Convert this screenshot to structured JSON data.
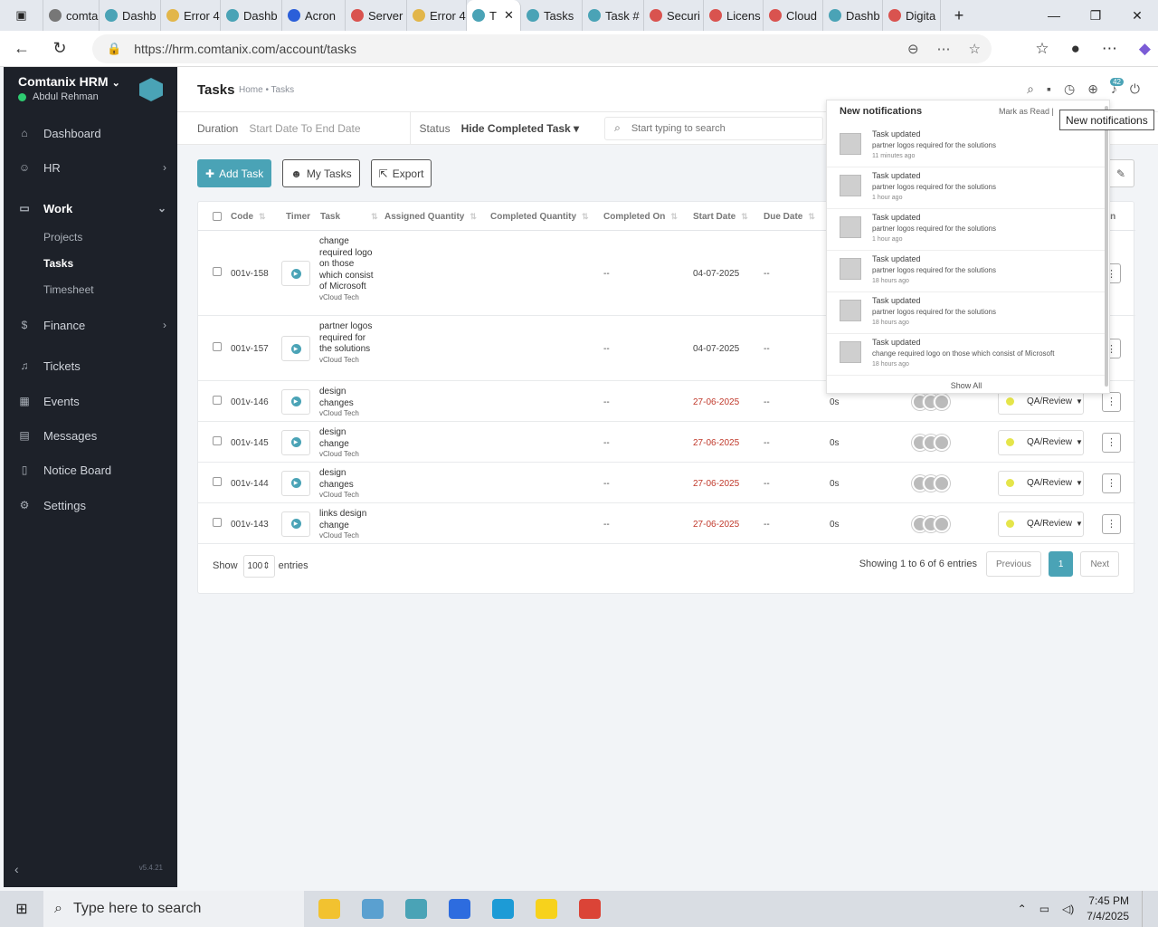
{
  "browser": {
    "tabs": [
      {
        "label": "comta",
        "color": "#777"
      },
      {
        "label": "Dashb",
        "color": "#4aa3b6"
      },
      {
        "label": "Error 4",
        "color": "#e2b64a"
      },
      {
        "label": "Dashb",
        "color": "#4aa3b6"
      },
      {
        "label": "Acron",
        "color": "#2b5fd9"
      },
      {
        "label": "Server",
        "color": "#d9534f"
      },
      {
        "label": "Error 4",
        "color": "#e2b64a"
      },
      {
        "label": "T",
        "color": "#4aa3b6",
        "active": true
      },
      {
        "label": "Tasks",
        "color": "#4aa3b6"
      },
      {
        "label": "Task #",
        "color": "#4aa3b6"
      },
      {
        "label": "Securi",
        "color": "#d9534f"
      },
      {
        "label": "Licens",
        "color": "#d9534f"
      },
      {
        "label": "Cloud",
        "color": "#d9534f"
      },
      {
        "label": "Dashb",
        "color": "#4aa3b6"
      },
      {
        "label": "Digita",
        "color": "#d9534f"
      }
    ],
    "url": "https://hrm.comtanix.com/account/tasks"
  },
  "sidebar": {
    "brand": "Comtanix HRM",
    "user": "Abdul Rehman",
    "items": [
      {
        "label": "Dashboard",
        "icon": "home-icon"
      },
      {
        "label": "HR",
        "icon": "users-icon"
      },
      {
        "label": "Work",
        "icon": "briefcase-icon"
      },
      {
        "label": "Finance",
        "icon": "dollar-icon"
      },
      {
        "label": "Tickets",
        "icon": "headset-icon"
      },
      {
        "label": "Events",
        "icon": "calendar-icon"
      },
      {
        "label": "Messages",
        "icon": "chat-icon"
      },
      {
        "label": "Notice Board",
        "icon": "clipboard-icon"
      },
      {
        "label": "Settings",
        "icon": "gear-icon"
      }
    ],
    "work_sub": [
      "Projects",
      "Tasks",
      "Timesheet"
    ],
    "version": "v5.4.21"
  },
  "page": {
    "title": "Tasks",
    "breadcrumb": "Home • Tasks",
    "notif_count": "42",
    "filters": {
      "duration_label": "Duration",
      "duration_value": "Start Date To End Date",
      "status_label": "Status",
      "status_value": "Hide Completed Task ▾",
      "search_placeholder": "Start typing to search"
    },
    "buttons": {
      "add": "Add Task",
      "my": "My Tasks",
      "export": "Export"
    }
  },
  "table": {
    "columns": [
      "Code",
      "Timer",
      "Task",
      "Assigned Quantity",
      "Completed Quantity",
      "Completed On",
      "Start Date",
      "Due Date",
      "on"
    ],
    "rows": [
      {
        "code": "001v-158",
        "task": "change required logo on those which consist of Microsoft",
        "project": "vCloud Tech",
        "completed_on": "--",
        "start": "04-07-2025",
        "due": "--",
        "hours": "",
        "status": "",
        "start_red": false
      },
      {
        "code": "001v-157",
        "task": "partner logos required for the solutions",
        "project": "vCloud Tech",
        "completed_on": "--",
        "start": "04-07-2025",
        "due": "--",
        "hours": "",
        "status": "",
        "start_red": false
      },
      {
        "code": "001v-146",
        "task": "design changes",
        "project": "vCloud Tech",
        "completed_on": "--",
        "start": "27-06-2025",
        "due": "--",
        "hours": "0s",
        "status": "QA/Review",
        "start_red": true
      },
      {
        "code": "001v-145",
        "task": "design change",
        "project": "vCloud Tech",
        "completed_on": "--",
        "start": "27-06-2025",
        "due": "--",
        "hours": "0s",
        "status": "QA/Review",
        "start_red": true
      },
      {
        "code": "001v-144",
        "task": "design changes",
        "project": "vCloud Tech",
        "completed_on": "--",
        "start": "27-06-2025",
        "due": "--",
        "hours": "0s",
        "status": "QA/Review",
        "start_red": true
      },
      {
        "code": "001v-143",
        "task": "links design change",
        "project": "vCloud Tech",
        "completed_on": "--",
        "start": "27-06-2025",
        "due": "--",
        "hours": "0s",
        "status": "QA/Review",
        "start_red": true
      }
    ],
    "footer": {
      "show": "Show",
      "entries_value": "100",
      "entries": "entries",
      "info": "Showing 1 to 6 of 6 entries",
      "prev": "Previous",
      "page": "1",
      "next": "Next"
    }
  },
  "notifications": {
    "title": "New notifications",
    "mark": "Mark as Read |",
    "tooltip": "New notifications",
    "show_all": "Show All",
    "items": [
      {
        "title": "Task updated",
        "text": "partner logos required for the solutions",
        "time": "11 minutes ago"
      },
      {
        "title": "Task updated",
        "text": "partner logos required for the solutions",
        "time": "1 hour ago"
      },
      {
        "title": "Task updated",
        "text": "partner logos required for the solutions",
        "time": "1 hour ago"
      },
      {
        "title": "Task updated",
        "text": "partner logos required for the solutions",
        "time": "18 hours ago"
      },
      {
        "title": "Task updated",
        "text": "partner logos required for the solutions",
        "time": "18 hours ago"
      },
      {
        "title": "Task updated",
        "text": "change required logo on those which consist of Microsoft",
        "time": "18 hours ago"
      }
    ]
  },
  "taskbar": {
    "search": "Type here to search",
    "time": "7:45 PM",
    "date": "7/4/2025",
    "apps": [
      {
        "name": "file-explorer-icon",
        "color": "#f2c230"
      },
      {
        "name": "app-icon",
        "color": "#5aa0d0"
      },
      {
        "name": "hrm-app-icon",
        "color": "#4aa3b6"
      },
      {
        "name": "zoom-icon",
        "color": "#2d6cdf"
      },
      {
        "name": "edge-icon",
        "color": "#1d9bd6"
      },
      {
        "name": "sticky-notes-icon",
        "color": "#f7d21c"
      },
      {
        "name": "chrome-icon",
        "color": "#db4437"
      }
    ]
  }
}
